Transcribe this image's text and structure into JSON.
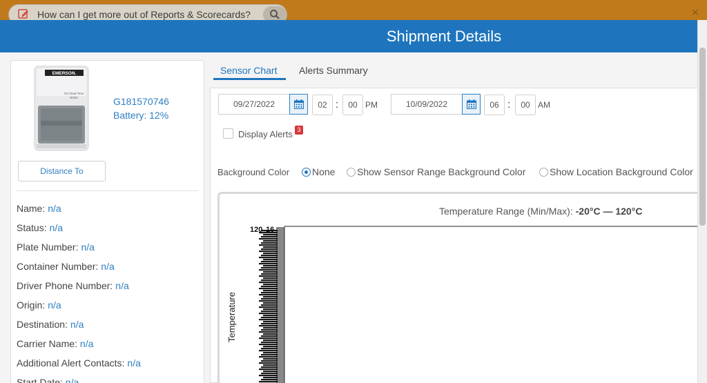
{
  "helpbar": {
    "placeholder": "How can I get more out of Reports & Scorecards?",
    "close_glyph": "✕"
  },
  "modal": {
    "title": "Shipment Details"
  },
  "device": {
    "brand": "EMERSON.",
    "model_line1": "GO Real-Time",
    "model_line2": "4G/5C",
    "id": "G181570746",
    "battery": "Battery: 12%",
    "distance_button": "Distance To"
  },
  "info": [
    {
      "label": "Name:",
      "value": "n/a"
    },
    {
      "label": "Status:",
      "value": "n/a"
    },
    {
      "label": "Plate Number:",
      "value": "n/a"
    },
    {
      "label": "Container Number:",
      "value": "n/a"
    },
    {
      "label": "Driver Phone Number:",
      "value": "n/a"
    },
    {
      "label": "Origin:",
      "value": "n/a"
    },
    {
      "label": "Destination:",
      "value": "n/a"
    },
    {
      "label": "Carrier Name:",
      "value": "n/a"
    },
    {
      "label": "Additional Alert Contacts:",
      "value": "n/a"
    },
    {
      "label": "Start Date:",
      "value": "n/a"
    }
  ],
  "tabs": {
    "sensor": "Sensor Chart",
    "alerts": "Alerts Summary"
  },
  "range": {
    "start_date": "09/27/2022",
    "start_hour": "02",
    "start_min": "00",
    "start_ampm": "PM",
    "end_date": "10/09/2022",
    "end_hour": "06",
    "end_min": "00",
    "end_ampm": "AM",
    "colon": ":"
  },
  "alerts": {
    "label": "Display Alerts",
    "count": "3"
  },
  "background": {
    "label": "Background Color",
    "options": [
      "None",
      "Show Sensor Range Background Color",
      "Show Location Background Color"
    ],
    "selected": "None"
  },
  "chart": {
    "title_prefix": "Temperature Range (Min/Max): ",
    "title_value": "-20°C — 120°C",
    "ylabel": "Temperature",
    "top_tick": "120",
    "top_tick_b": "16"
  },
  "colors": {
    "accent": "#1f75bd",
    "helpbar": "#c07a1c",
    "badge": "#d9363e"
  },
  "icons": [
    "edit-icon",
    "search-icon",
    "close-icon",
    "calendar-icon"
  ]
}
